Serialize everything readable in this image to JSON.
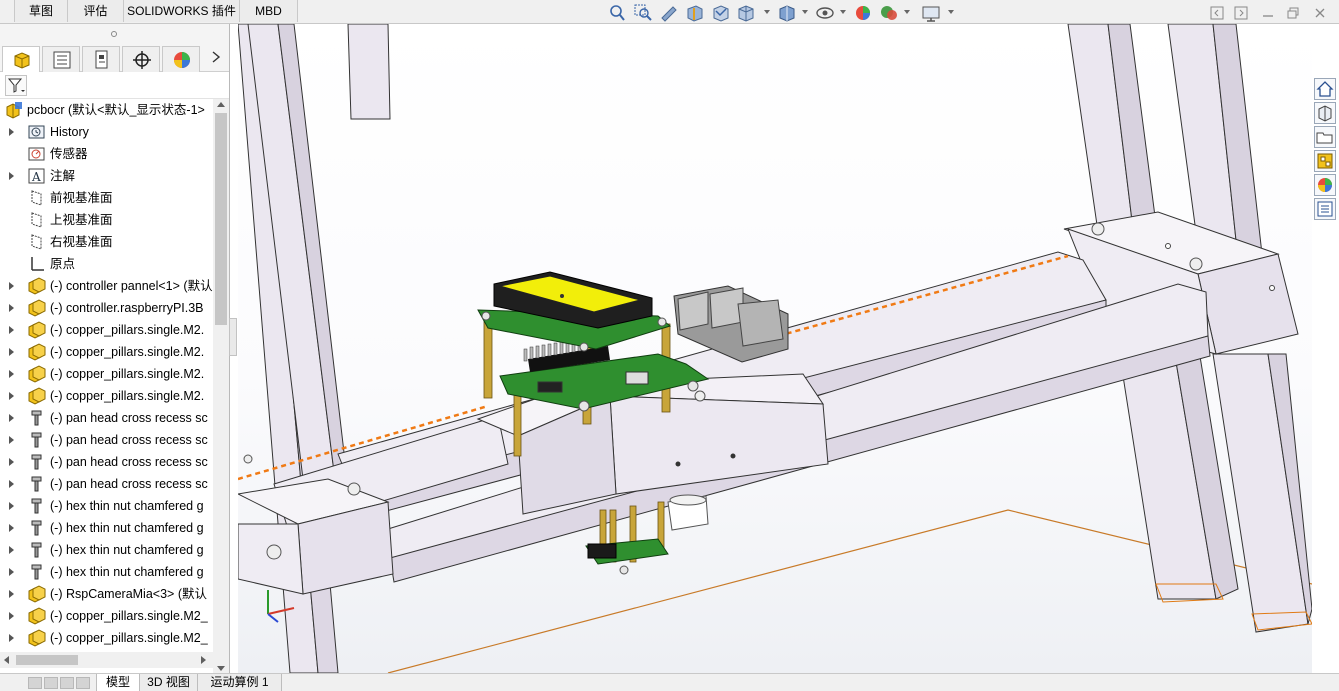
{
  "command_manager": {
    "tabs": [
      {
        "label": "草图"
      },
      {
        "label": "评估"
      },
      {
        "label": "SOLIDWORKS 插件"
      },
      {
        "label": "MBD"
      }
    ]
  },
  "view_toolbar": {
    "icons": [
      "zoom-to-fit-icon",
      "zoom-area-icon",
      "previous-view-icon",
      "section-view-icon",
      "dynamic-annotation-icon",
      "view-orientation-icon",
      "display-style-icon",
      "hide-show-items-icon",
      "edit-appearance-icon",
      "apply-scene-icon",
      "view-settings-icon"
    ]
  },
  "feature_manager": {
    "tabs": [
      "feature-manager-icon",
      "property-manager-icon",
      "configuration-manager-icon",
      "dimxpert-manager-icon",
      "display-manager-icon"
    ],
    "root": {
      "label": "pcbocr  (默认<默认_显示状态-1>",
      "icon": "assembly-icon"
    },
    "items": [
      {
        "label": "History",
        "icon": "history-icon",
        "expandable": true
      },
      {
        "label": "传感器",
        "icon": "sensor-icon",
        "expandable": false
      },
      {
        "label": "注解",
        "icon": "annotation-icon",
        "expandable": true
      },
      {
        "label": "前视基准面",
        "icon": "plane-icon",
        "expandable": false
      },
      {
        "label": "上视基准面",
        "icon": "plane-icon",
        "expandable": false
      },
      {
        "label": "右视基准面",
        "icon": "plane-icon",
        "expandable": false
      },
      {
        "label": "原点",
        "icon": "origin-icon",
        "expandable": false
      },
      {
        "label": "(-) controller pannel<1> (默认",
        "icon": "subassembly-icon",
        "expandable": true
      },
      {
        "label": "(-) controller.raspberryPI.3B",
        "icon": "subassembly-icon",
        "expandable": true
      },
      {
        "label": "(-) copper_pillars.single.M2.",
        "icon": "subassembly-icon",
        "expandable": true
      },
      {
        "label": "(-) copper_pillars.single.M2.",
        "icon": "subassembly-icon",
        "expandable": true
      },
      {
        "label": "(-) copper_pillars.single.M2.",
        "icon": "subassembly-icon",
        "expandable": true
      },
      {
        "label": "(-) copper_pillars.single.M2.",
        "icon": "subassembly-icon",
        "expandable": true
      },
      {
        "label": "(-) pan head cross recess sc",
        "icon": "part-icon",
        "expandable": true
      },
      {
        "label": "(-) pan head cross recess sc",
        "icon": "part-icon",
        "expandable": true
      },
      {
        "label": "(-) pan head cross recess sc",
        "icon": "part-icon",
        "expandable": true
      },
      {
        "label": "(-) pan head cross recess sc",
        "icon": "part-icon",
        "expandable": true
      },
      {
        "label": "(-) hex thin nut chamfered g",
        "icon": "part-icon",
        "expandable": true
      },
      {
        "label": "(-) hex thin nut chamfered g",
        "icon": "part-icon",
        "expandable": true
      },
      {
        "label": "(-) hex thin nut chamfered g",
        "icon": "part-icon",
        "expandable": true
      },
      {
        "label": "(-) hex thin nut chamfered g",
        "icon": "part-icon",
        "expandable": true
      },
      {
        "label": "(-) RspCameraMia<3> (默认",
        "icon": "subassembly-icon",
        "expandable": true
      },
      {
        "label": "(-) copper_pillars.single.M2_",
        "icon": "subassembly-icon",
        "expandable": true
      },
      {
        "label": "(-) copper_pillars.single.M2_",
        "icon": "subassembly-icon",
        "expandable": true
      }
    ]
  },
  "bottom_tabs": [
    {
      "label": "模型"
    },
    {
      "label": "3D 视图"
    },
    {
      "label": "运动算例 1"
    }
  ],
  "task_pane": {
    "icons": [
      "solidworks-resources-icon",
      "design-library-icon",
      "file-explorer-icon",
      "view-palette-icon",
      "appearances-scenes-icon",
      "custom-properties-icon"
    ]
  },
  "colors": {
    "frame": "#ebe7f0",
    "lcd_screen": "#f2ee0a",
    "pcb": "#2f8f2f",
    "pillar": "#c8a53a",
    "centerline": "#f07a14",
    "plane_outline": "#c87a28",
    "tree_icon": "#e6b400"
  }
}
